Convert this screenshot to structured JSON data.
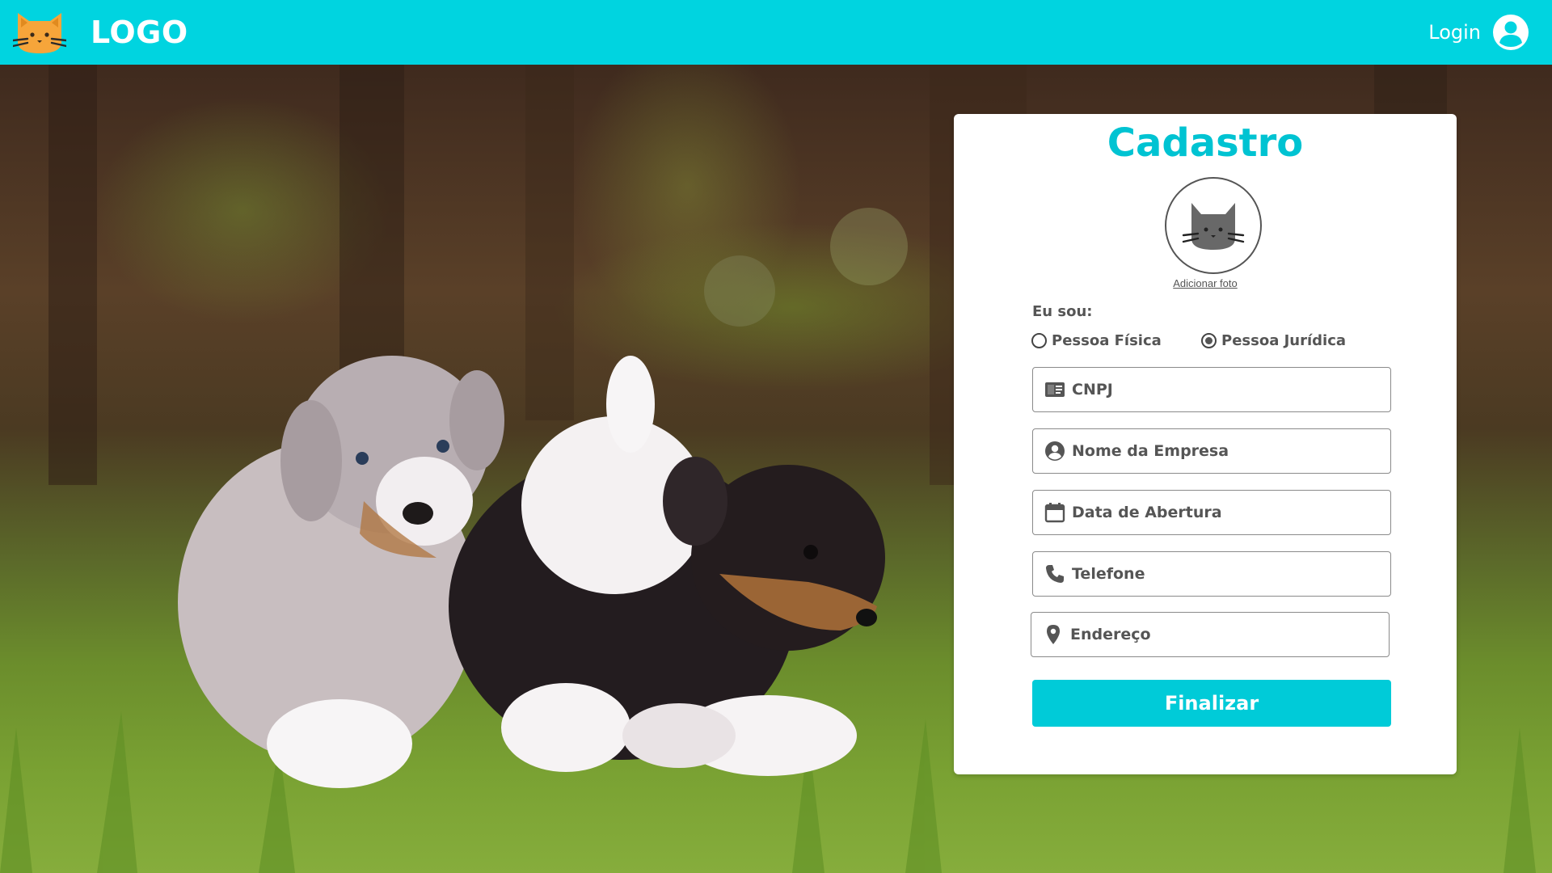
{
  "header": {
    "logo_text": "LOGO",
    "logo_icon": "cat-face-icon",
    "login_label": "Login",
    "login_icon": "account-circle-icon",
    "background_color": "#00d4e0"
  },
  "hero": {
    "image_subject": "two puppies running on grass"
  },
  "form": {
    "title": "Cadastro",
    "avatar_icon": "cat-face-icon",
    "add_photo_label": "Adicionar foto",
    "person_type_label": "Eu sou:",
    "person_type_options": [
      {
        "label": "Pessoa Física",
        "selected": false
      },
      {
        "label": "Pessoa Jurídica",
        "selected": true
      }
    ],
    "fields": [
      {
        "icon": "id-card-icon",
        "placeholder": "CNPJ"
      },
      {
        "icon": "account-circle-icon",
        "placeholder": "Nome da Empresa"
      },
      {
        "icon": "calendar-icon",
        "placeholder": "Data de Abertura"
      },
      {
        "icon": "phone-icon",
        "placeholder": "Telefone"
      },
      {
        "icon": "map-pin-icon",
        "placeholder": "Endereço"
      }
    ],
    "submit_label": "Finalizar",
    "accent_color": "#00c3d2"
  }
}
